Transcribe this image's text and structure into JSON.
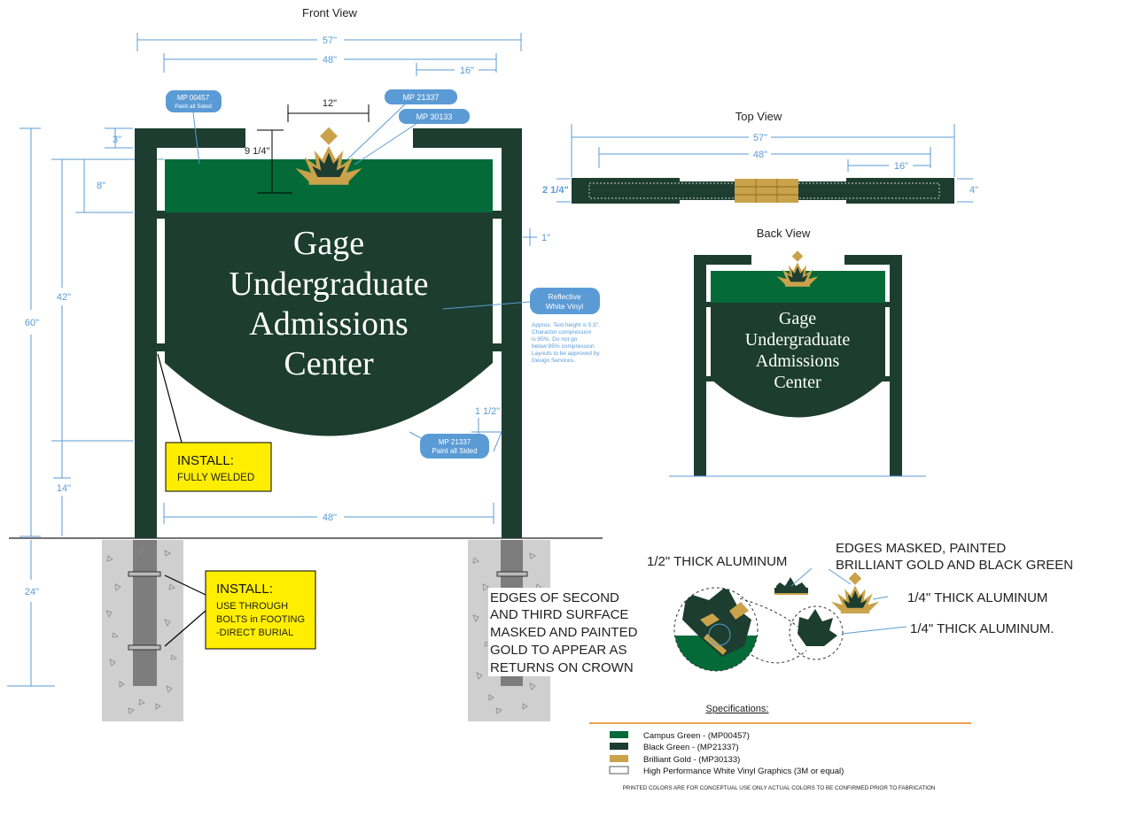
{
  "views": {
    "front_title": "Front View",
    "top_title": "Top View",
    "back_title": "Back View"
  },
  "sign_text": [
    "Gage",
    "Undergraduate",
    "Admissions",
    "Center"
  ],
  "dimensions": {
    "front_57": "57\"",
    "front_48_top": "48\"",
    "front_16": "16\"",
    "front_12": "12\"",
    "front_9_25": "9 1/4\"",
    "front_3": "3\"",
    "front_8": "8\"",
    "front_42": "42\"",
    "front_60": "60\"",
    "front_14": "14\"",
    "front_24": "24\"",
    "front_1": "1\"",
    "front_1_5": "1 1/2\"",
    "front_48_bottom": "48\"",
    "top_57": "57\"",
    "top_48": "48\"",
    "top_16": "16\"",
    "top_2_25": "2 1/4\"",
    "top_4": "4\""
  },
  "callouts": {
    "mp00457_line1": "MP 00457",
    "mp00457_line2": "Paint all Sided",
    "mp21337_top": "MP 21337",
    "mp30133": "MP 30133",
    "reflective_line1": "Reflective",
    "reflective_line2": "White Vinyl",
    "mp21337_bottom_line1": "MP 21337",
    "mp21337_bottom_line2": "Paint all Sided"
  },
  "text_note": [
    "Approx. Text height is 5.5\".",
    "Charactor compression",
    "is 95%. Do not go",
    "below 85% compression.",
    "Layouts to be approved by",
    "Design Services."
  ],
  "install_welded": {
    "title": "INSTALL:",
    "body": "FULLY WELDED"
  },
  "install_bolts": {
    "title": "INSTALL:",
    "body": [
      "USE THROUGH",
      "BOLTS in FOOTING",
      "-DIRECT BURIAL"
    ]
  },
  "detail_labels": {
    "half_inch": "1/2\" THICK ALUMINUM",
    "edges_masked": [
      "EDGES MASKED, PAINTED",
      "BRILLIANT GOLD AND BLACK GREEN"
    ],
    "quarter_inch_1": "1/4\" THICK ALUMINUM",
    "quarter_inch_2": "1/4\" THICK ALUMINUM.",
    "edges_second": [
      "EDGES OF SECOND",
      "AND THIRD SURFACE",
      "MASKED AND PAINTED",
      "GOLD TO APPEAR AS",
      "RETURNS ON CROWN"
    ]
  },
  "specifications": {
    "title": "Specifications:",
    "items": [
      {
        "label": "Campus Green - (MP00457)",
        "color": "#046a38"
      },
      {
        "label": "Black Green - (MP21337)",
        "color": "#1c3d30"
      },
      {
        "label": "Brilliant Gold - (MP30133)",
        "color": "#c9a24a"
      },
      {
        "label": "High Performance White Vinyl Graphics (3M or equal)",
        "color": "#ffffff"
      }
    ],
    "footnote": "PRINTED COLORS ARE FOR CONCEPTUAL USE ONLY  ACTUAL COLORS TO BE CONFIRMED PRIOR TO FABRICATION"
  },
  "colors": {
    "campus_green": "#046a38",
    "black_green": "#1c3d30",
    "gold": "#c9a24a",
    "dim_blue": "#5b9bd5",
    "install_yellow": "#ffee00",
    "concrete": "#cfcfcf",
    "orange_rule": "#f0a050"
  }
}
